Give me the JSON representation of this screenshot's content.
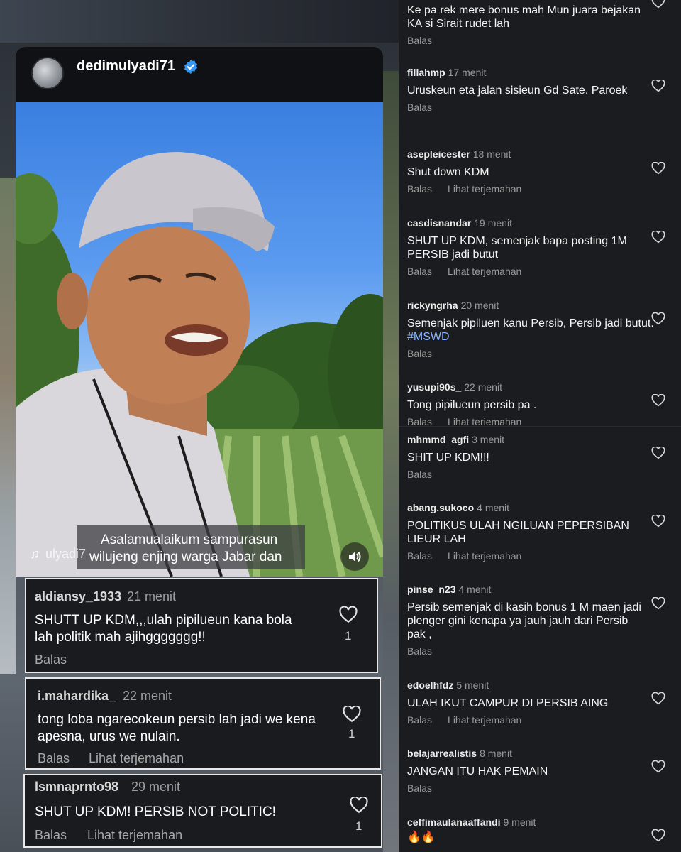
{
  "post": {
    "username": "dedimulyadi71",
    "subtitle_line1": "Asalamualaikum sampurasun",
    "subtitle_line2": "wilujeng enjing warga Jabar dan",
    "audio_text": "ulyadi7"
  },
  "overlay_comments": [
    {
      "user": "aldiansy_1933",
      "time": "21 menit",
      "text": "SHUTT UP KDM,,,ulah pipilueun kana bola lah politik mah ajihggggggg!!",
      "reply": "Balas",
      "translate": "",
      "likes": "1"
    },
    {
      "user": "i.mahardika_",
      "time": "22 menit",
      "text": "tong loba ngarecokeun persib lah jadi we kena apesna, urus we nulain.",
      "reply": "Balas",
      "translate": "Lihat terjemahan",
      "likes": "1"
    },
    {
      "user": "lsmnaprnto98",
      "time": "29 menit",
      "text": "SHUT UP KDM! PERSIB NOT POLITIC!",
      "reply": "Balas",
      "translate": "Lihat terjemahan",
      "likes": "1"
    }
  ],
  "right_comments": [
    {
      "user": "",
      "time": "",
      "text": "Ke pa rek mere bonus mah Mun juara bejakan KA si Sirait rudet lah",
      "reply": "Balas",
      "translate": ""
    },
    {
      "user": "fillahmp",
      "time": "17 menit",
      "text": "Uruskeun eta jalan sisieun Gd Sate. Paroek",
      "reply": "Balas",
      "translate": ""
    },
    {
      "user": "asepleicester",
      "time": "18 menit",
      "text": "Shut down KDM",
      "reply": "Balas",
      "translate": "Lihat terjemahan"
    },
    {
      "user": "casdisnandar",
      "time": "19 menit",
      "text": "SHUT UP KDM, semenjak bapa posting 1M PERSIB jadi butut",
      "reply": "Balas",
      "translate": "Lihat terjemahan"
    },
    {
      "user": "rickyngrha",
      "time": "20 menit",
      "text": "Semenjak pipiluen kanu Persib, Persib jadi butut.",
      "hashtag": "#MSWD",
      "reply": "Balas",
      "translate": ""
    },
    {
      "user": "yusupi90s_",
      "time": "22 menit",
      "text": "Tong pipilueun persib pa .",
      "reply": "Balas",
      "translate": "Lihat terjemahan"
    },
    {
      "user": "mhmmd_agfi",
      "time": "3 menit",
      "text": "SHIT UP KDM!!!",
      "reply": "Balas",
      "translate": ""
    },
    {
      "user": "abang.sukoco",
      "time": "4 menit",
      "text": "POLITIKUS ULAH NGILUAN PEPERSIBAN LIEUR LAH",
      "reply": "Balas",
      "translate": "Lihat terjemahan"
    },
    {
      "user": "pinse_n23",
      "time": "4 menit",
      "text": "Persib semenjak di kasih bonus 1 M maen jadi plenger gini kenapa ya jauh jauh dari Persib pak ,",
      "reply": "Balas",
      "translate": ""
    },
    {
      "user": "edoelhfdz",
      "time": "5 menit",
      "text": "ULAH IKUT CAMPUR DI PERSIB AING",
      "reply": "Balas",
      "translate": "Lihat terjemahan"
    },
    {
      "user": "belajarrealistis",
      "time": "8 menit",
      "text": "JANGAN ITU HAK PEMAIN",
      "reply": "Balas",
      "translate": ""
    },
    {
      "user": "ceffimaulanaaffandi",
      "time": "9 menit",
      "text": "🔥🔥",
      "reply": "",
      "translate": ""
    }
  ]
}
